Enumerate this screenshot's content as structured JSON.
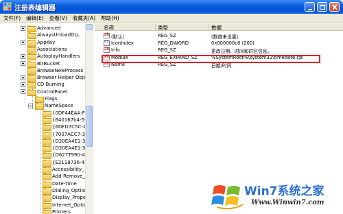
{
  "window": {
    "title": "注册表编辑器",
    "accent": "#0553d6"
  },
  "menu": [
    "文件(F)",
    "编辑(E)",
    "查看(V)",
    "收藏夹(A)",
    "帮助(H)"
  ],
  "tree": {
    "items": [
      {
        "label": "Advanced",
        "expander": "plus"
      },
      {
        "label": "AlwaysUnloadDLL",
        "expander": "none"
      },
      {
        "label": "AppKey",
        "expander": "plus"
      },
      {
        "label": "Associations",
        "expander": "none"
      },
      {
        "label": "AutoplayHandlers",
        "expander": "plus"
      },
      {
        "label": "BitBucket",
        "expander": "plus"
      },
      {
        "label": "BrowseNewProcess",
        "expander": "none"
      },
      {
        "label": "Browser Helper Objec",
        "expander": "plus"
      },
      {
        "label": "CD Burning",
        "expander": "plus"
      },
      {
        "label": "ControlPanel",
        "expander": "minus"
      },
      {
        "label": "Flags",
        "expander": "none"
      },
      {
        "label": "NameSpace",
        "expander": "minus"
      },
      {
        "label": "{0DF44EAA-FF21",
        "expander": "none"
      },
      {
        "label": "{640167b4-59b0",
        "expander": "none"
      },
      {
        "label": "{6DFD7C5C-2451",
        "expander": "none"
      },
      {
        "label": "{7007ACC7-3202",
        "expander": "none"
      },
      {
        "label": "{D20EA4E1-3957",
        "expander": "none"
      },
      {
        "label": "{D20EA4E1-3957",
        "expander": "none"
      },
      {
        "label": "{D627T990-4C6A",
        "expander": "none"
      },
      {
        "label": "{E2118736-43FE",
        "expander": "none"
      },
      {
        "label": "Accessibility_",
        "expander": "none"
      },
      {
        "label": "Add-Remove_Pro",
        "expander": "none"
      },
      {
        "label": "Date-Time",
        "expander": "none"
      },
      {
        "label": "Dialing_Option",
        "expander": "none"
      },
      {
        "label": "Display_Proper",
        "expander": "none"
      },
      {
        "label": "Internet_Optic",
        "expander": "none"
      },
      {
        "label": "Printers",
        "expander": "none"
      }
    ]
  },
  "list": {
    "columns": [
      "名称",
      "类型",
      "数据"
    ],
    "rows": [
      {
        "name": "(默认)",
        "type": "REG_SZ",
        "data": "(数值未设置)",
        "icon": "ab"
      },
      {
        "name": "IconIndex",
        "type": "REG_DWORD",
        "data": "0x000000c8 (200)",
        "icon": "bin"
      },
      {
        "name": "Info",
        "type": "REG_SZ",
        "data": "更改日期、时间和时区信息。",
        "icon": "ab"
      },
      {
        "name": "Module",
        "type": "REG_EXPAND_SZ",
        "data": "%SystemRoot%\\system32\\timedate.cpl",
        "icon": "ab"
      },
      {
        "name": "Name",
        "type": "REG_SZ",
        "data": "日期/时间",
        "icon": "ab"
      }
    ],
    "highlight_color": "#d9222a"
  },
  "watermark": {
    "brand": "Win7系统之家",
    "url": "Www.Winwin7.com"
  }
}
